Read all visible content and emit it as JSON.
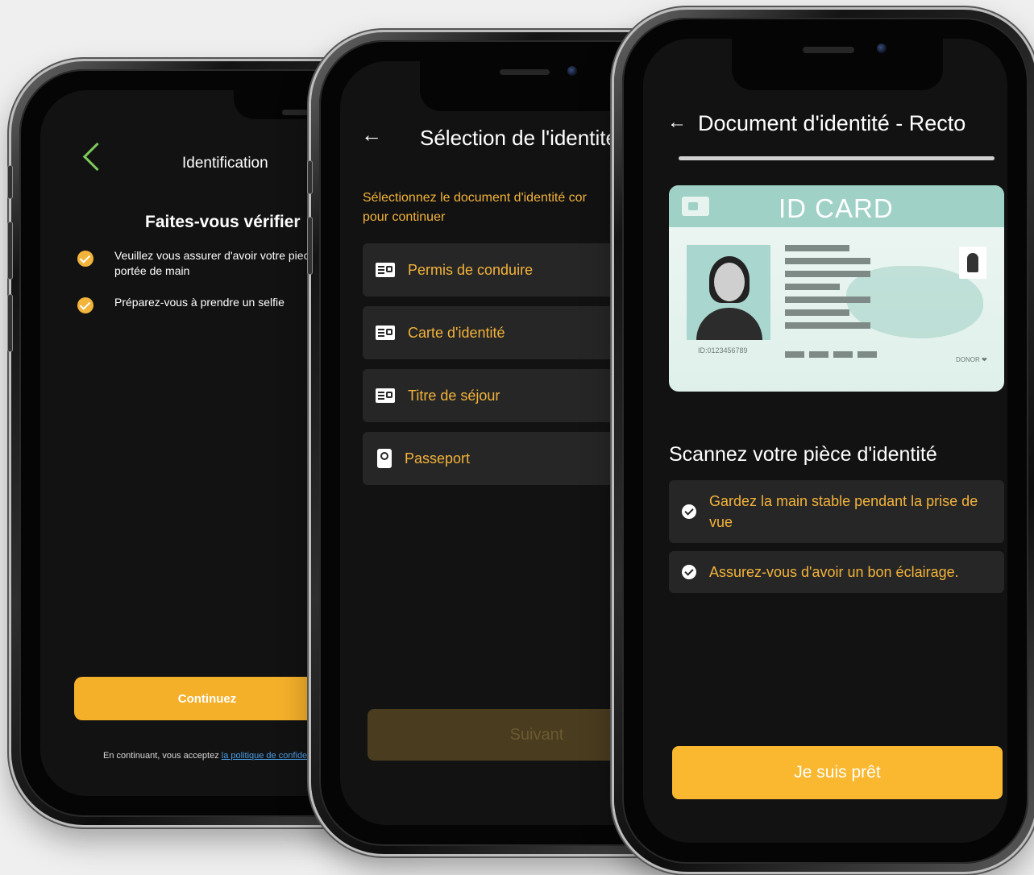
{
  "screens": [
    {
      "header": {
        "title": "Identification",
        "back_icon": "chevron-left-icon"
      },
      "heading": "Faites-vous vérifier",
      "checklist": [
        {
          "text": "Veuillez vous assurer d'avoir votre piece d'\nportée de main"
        },
        {
          "text": "Préparez-vous à prendre un selfie"
        }
      ],
      "primary_button": "Continuez",
      "footer": {
        "text": "En continuant, vous acceptez ",
        "link": "la politique de confidentia"
      }
    },
    {
      "header": {
        "title": "Sélection de l'identité",
        "back_icon": "arrow-left-icon"
      },
      "subtitle": "Sélectionnez le document d'identité cor\npour continuer",
      "options": [
        {
          "label": "Permis de conduire",
          "icon": "driver-license-icon"
        },
        {
          "label": "Carte d'identité",
          "icon": "id-card-icon"
        },
        {
          "label": "Titre de séjour",
          "icon": "residence-permit-icon"
        },
        {
          "label": "Passeport",
          "icon": "passport-icon"
        }
      ],
      "primary_button": "Suivant"
    },
    {
      "header": {
        "title": "Document d'identité - Recto",
        "back_icon": "arrow-left-icon"
      },
      "progress": 1.0,
      "id_card": {
        "title": "ID CARD",
        "id_number": "ID:0123456789",
        "donor": "DONOR"
      },
      "heading": "Scannez votre pièce d'identité",
      "tips": [
        {
          "text": "Gardez la main stable pendant la prise de vue"
        },
        {
          "text": "Assurez-vous d'avoir un bon éclairage."
        }
      ],
      "primary_button": "Je suis prêt"
    }
  ],
  "colors": {
    "accent": "#f5b02a",
    "screen_bg": "#121212",
    "card_bg": "#262626",
    "back_chevron": "#7ec95b",
    "link": "#4a9fe8",
    "disabled_button": "#4a3c1f"
  }
}
